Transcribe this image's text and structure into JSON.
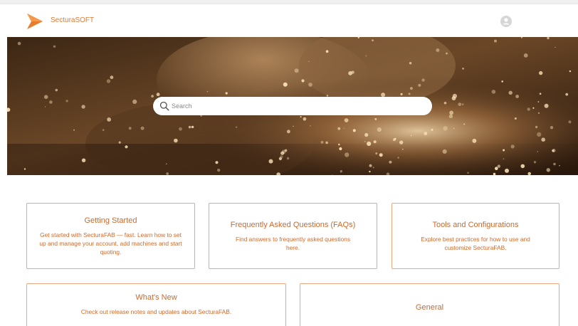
{
  "header": {
    "brand": "SecturaSOFT",
    "logo_icon": "play-arrow-logo",
    "avatar_icon": "user-avatar-icon"
  },
  "hero": {
    "background": "welding-sparks-photo",
    "search": {
      "placeholder": "Search",
      "value": "",
      "icon": "search-icon"
    }
  },
  "cards": [
    {
      "title": "Getting Started",
      "description": "Get started with SecturaFAB — fast. Learn how to set up and manage your account, add machines and start quoting."
    },
    {
      "title": "Frequently Asked Questions (FAQs)",
      "description": "Find answers to frequently asked questions here."
    },
    {
      "title": "Tools and Configurations",
      "description": "Explore best practices for how to use and customize SecturaFAB."
    },
    {
      "title": "What's New",
      "description": "Check out release notes and updates about SecturaFAB."
    },
    {
      "title": "General",
      "description": ""
    }
  ],
  "colors": {
    "accent": "#e07a33",
    "card_border": "#e8a77e",
    "card_text": "#d0692a"
  }
}
